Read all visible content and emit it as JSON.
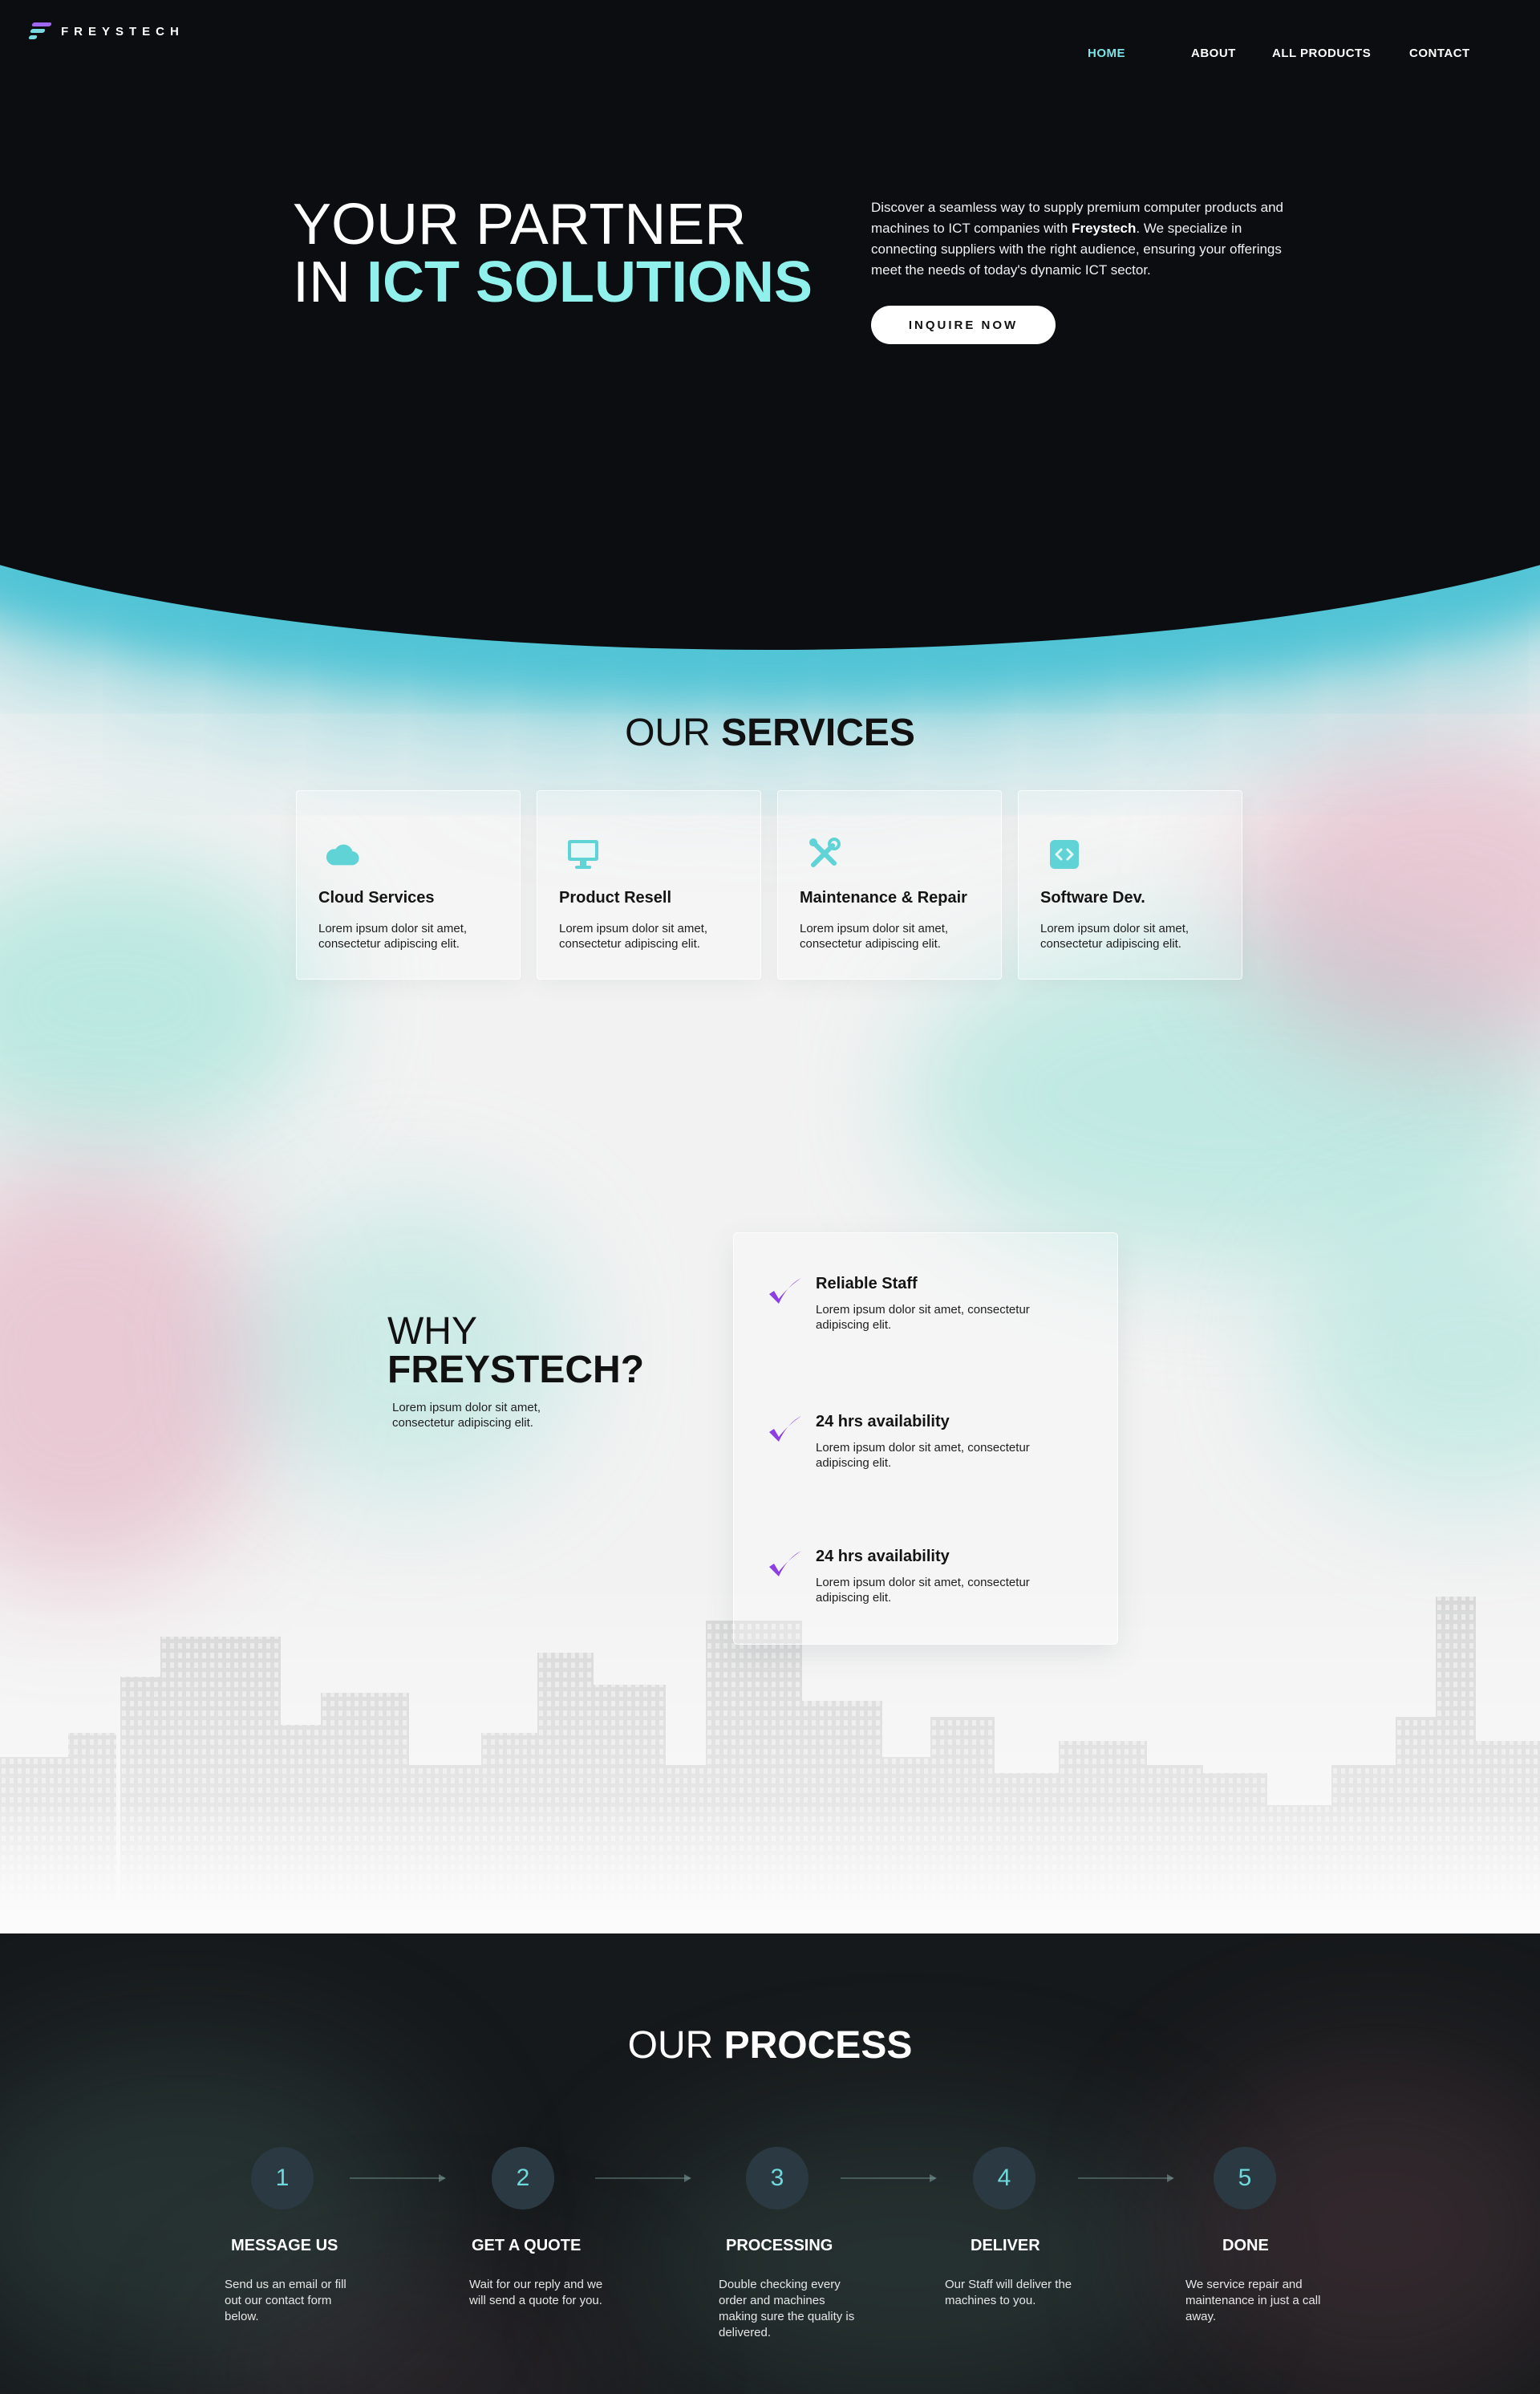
{
  "brand": {
    "name": "FREYSTECH"
  },
  "nav": {
    "items": [
      {
        "label": "HOME",
        "active": true
      },
      {
        "label": "ABOUT",
        "active": false
      },
      {
        "label": "ALL PRODUCTS",
        "active": false
      },
      {
        "label": "CONTACT",
        "active": false
      }
    ]
  },
  "hero": {
    "title_line1": "YOUR PARTNER",
    "title_line2_prefix": "IN ",
    "title_line2_accent": "ICT SOLUTIONS",
    "desc_part1": "Discover a seamless way to supply premium computer products and machines to ICT companies with ",
    "desc_brand": "Freystech",
    "desc_part2": ". We specialize in connecting suppliers with the right audience, ensuring your offerings meet the needs of today's dynamic ICT sector.",
    "cta_label": "INQUIRE NOW"
  },
  "services": {
    "title_light": "OUR ",
    "title_bold": "SERVICES",
    "cards": [
      {
        "icon": "cloud-icon",
        "title": "Cloud Services",
        "text": "Lorem ipsum dolor sit amet, consectetur adipiscing elit."
      },
      {
        "icon": "monitor-icon",
        "title": "Product Resell",
        "text": "Lorem ipsum dolor sit amet, consectetur adipiscing elit."
      },
      {
        "icon": "tools-icon",
        "title": "Maintenance & Repair",
        "text": "Lorem ipsum dolor sit amet, consectetur adipiscing elit."
      },
      {
        "icon": "code-icon",
        "title": "Software Dev.",
        "text": "Lorem ipsum dolor sit amet, consectetur adipiscing elit."
      }
    ]
  },
  "why": {
    "title_light": "WHY",
    "title_bold": "FREYSTECH?",
    "text": "Lorem ipsum dolor sit amet, consectetur adipiscing elit.",
    "features": [
      {
        "icon": "checkmark-icon",
        "title": "Reliable Staff",
        "text": "Lorem ipsum dolor sit amet, consectetur adipiscing elit."
      },
      {
        "icon": "checkmark-icon",
        "title": "24 hrs availability",
        "text": "Lorem ipsum dolor sit amet, consectetur adipiscing elit."
      },
      {
        "icon": "checkmark-icon",
        "title": "24 hrs availability",
        "text": "Lorem ipsum dolor sit amet, consectetur adipiscing elit."
      }
    ]
  },
  "process": {
    "title_light": "OUR ",
    "title_bold": "PROCESS",
    "steps": [
      {
        "number": "1",
        "title": "MESSAGE US",
        "text": "Send us an email or fill out our contact form below."
      },
      {
        "number": "2",
        "title": "GET A QUOTE",
        "text": "Wait for our reply and we will send a quote for you."
      },
      {
        "number": "3",
        "title": "PROCESSING",
        "text": "Double checking every order and machines making sure the quality is delivered."
      },
      {
        "number": "4",
        "title": "DELIVER",
        "text": "Our Staff will deliver the machines to you."
      },
      {
        "number": "5",
        "title": "DONE",
        "text": "We service repair and maintenance in just a call away."
      }
    ]
  },
  "colors": {
    "accent_teal": "#8ff0ec",
    "check_purple": "#8b3fe0",
    "dark_bg": "#0c0d11"
  }
}
